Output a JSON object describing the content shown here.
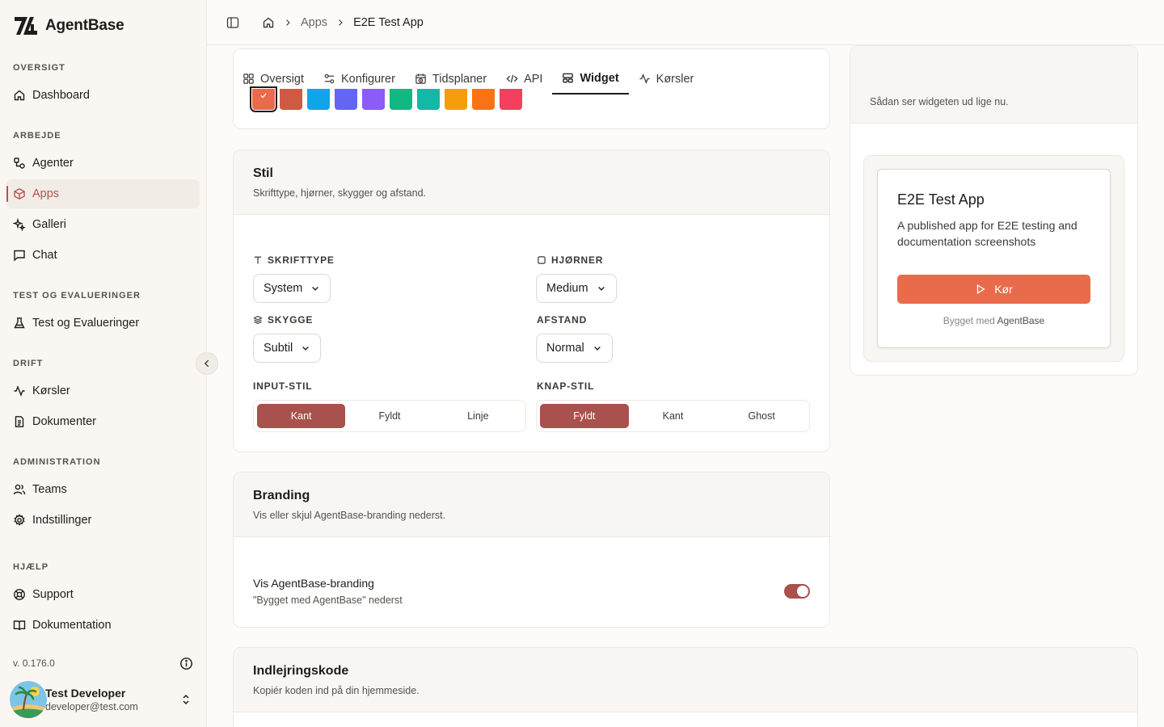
{
  "brand": {
    "name": "AgentBase"
  },
  "sidebar": {
    "sections": [
      {
        "label": "OVERSIGT",
        "items": [
          {
            "label": "Dashboard",
            "icon": "home-icon"
          }
        ]
      },
      {
        "label": "ARBEJDE",
        "items": [
          {
            "label": "Agenter",
            "icon": "agents-icon"
          },
          {
            "label": "Apps",
            "icon": "box-icon",
            "active": true
          },
          {
            "label": "Galleri",
            "icon": "sparkles-icon"
          },
          {
            "label": "Chat",
            "icon": "message-icon"
          }
        ]
      },
      {
        "label": "TEST OG EVALUERINGER",
        "items": [
          {
            "label": "Test og Evalueringer",
            "icon": "flask-icon"
          }
        ]
      },
      {
        "label": "DRIFT",
        "items": [
          {
            "label": "Kørsler",
            "icon": "activity-icon"
          },
          {
            "label": "Dokumenter",
            "icon": "document-icon"
          }
        ]
      },
      {
        "label": "ADMINISTRATION",
        "items": [
          {
            "label": "Teams",
            "icon": "users-icon"
          },
          {
            "label": "Indstillinger",
            "icon": "gear-icon"
          }
        ]
      },
      {
        "label": "HJÆLP",
        "items": [
          {
            "label": "Support",
            "icon": "lifebuoy-icon"
          },
          {
            "label": "Dokumentation",
            "icon": "book-icon"
          }
        ]
      }
    ],
    "version": "v. 0.176.0",
    "user": {
      "name": "Test Developer",
      "email": "developer@test.com"
    }
  },
  "breadcrumb": {
    "section": "Apps",
    "current": "E2E Test App"
  },
  "tabs": [
    {
      "label": "Oversigt"
    },
    {
      "label": "Konfigurer"
    },
    {
      "label": "Tidsplaner"
    },
    {
      "label": "API"
    },
    {
      "label": "Widget",
      "active": true
    },
    {
      "label": "Kørsler"
    }
  ],
  "colors": {
    "accent": "#a9514c",
    "swatches": [
      "#e96b4c",
      "#cf5a44",
      "#0ea5e9",
      "#6366f1",
      "#8b5cf6",
      "#10b981",
      "#14b8a6",
      "#f59e0b",
      "#f97316",
      "#f43f5e"
    ]
  },
  "style_card": {
    "title": "Stil",
    "subtitle": "Skrifttype, hjørner, skygger og afstand.",
    "font_label": "SKRIFTTYPE",
    "font_value": "System",
    "corners_label": "HJØRNER",
    "corners_value": "Medium",
    "shadow_label": "SKYGGE",
    "shadow_value": "Subtil",
    "spacing_label": "AFSTAND",
    "spacing_value": "Normal",
    "input_style_label": "INPUT-STIL",
    "input_style_options": [
      "Kant",
      "Fyldt",
      "Linje"
    ],
    "button_style_label": "KNAP-STIL",
    "button_style_options": [
      "Fyldt",
      "Kant",
      "Ghost"
    ]
  },
  "branding_card": {
    "title": "Branding",
    "subtitle": "Vis eller skjul AgentBase-branding nederst.",
    "toggle_label": "Vis AgentBase-branding",
    "toggle_hint": "\"Bygget med AgentBase\" nederst",
    "toggle_on": true
  },
  "embed_card": {
    "title": "Indlejringskode",
    "subtitle": "Kopiér koden ind på din hjemmeside."
  },
  "preview": {
    "subtitle": "Sådan ser widgeten ud lige nu.",
    "app_title": "E2E Test App",
    "app_desc": "A published app for E2E testing and documentation screenshots",
    "run_label": "Kør",
    "built_prefix": "Bygget med",
    "built_brand": "AgentBase"
  }
}
